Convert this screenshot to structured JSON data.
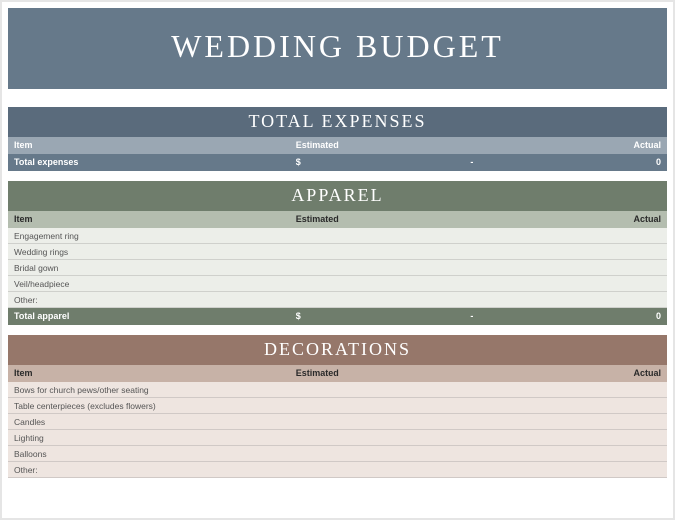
{
  "title": "WEDDING BUDGET",
  "columns": {
    "item": "Item",
    "estimated": "Estimated",
    "actual": "Actual"
  },
  "sections": {
    "total_expenses": {
      "heading": "TOTAL EXPENSES",
      "total": {
        "label": "Total expenses",
        "currency": "$",
        "estimated": "-",
        "actual": "0"
      }
    },
    "apparel": {
      "heading": "APPAREL",
      "rows": [
        {
          "item": "Engagement ring"
        },
        {
          "item": "Wedding rings"
        },
        {
          "item": "Bridal gown"
        },
        {
          "item": "Veil/headpiece"
        },
        {
          "item": "Other:"
        }
      ],
      "total": {
        "label": "Total apparel",
        "currency": "$",
        "estimated": "-",
        "actual": "0"
      }
    },
    "decorations": {
      "heading": "DECORATIONS",
      "rows": [
        {
          "item": "Bows for church pews/other seating"
        },
        {
          "item": "Table centerpieces (excludes flowers)"
        },
        {
          "item": "Candles"
        },
        {
          "item": "Lighting"
        },
        {
          "item": "Balloons"
        },
        {
          "item": "Other:"
        }
      ]
    }
  }
}
